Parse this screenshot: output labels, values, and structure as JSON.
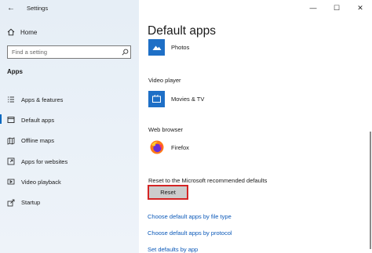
{
  "window": {
    "title": "Settings",
    "back_glyph": "←",
    "minimize_glyph": "—",
    "maximize_glyph": "☐",
    "close_glyph": "✕"
  },
  "sidebar": {
    "home_label": "Home",
    "search_placeholder": "Find a setting",
    "section_title": "Apps",
    "items": [
      {
        "label": "Apps & features",
        "icon": "apps-list-icon"
      },
      {
        "label": "Default apps",
        "icon": "default-apps-icon",
        "active": true
      },
      {
        "label": "Offline maps",
        "icon": "map-icon"
      },
      {
        "label": "Apps for websites",
        "icon": "web-link-icon"
      },
      {
        "label": "Video playback",
        "icon": "video-icon"
      },
      {
        "label": "Startup",
        "icon": "startup-icon"
      }
    ]
  },
  "main": {
    "title": "Default apps",
    "photos_app": "Photos",
    "video_label": "Video player",
    "video_app": "Movies & TV",
    "browser_label": "Web browser",
    "browser_app": "Firefox",
    "reset_label": "Reset to the Microsoft recommended defaults",
    "reset_button": "Reset",
    "links": [
      "Choose default apps by file type",
      "Choose default apps by protocol",
      "Set defaults by app"
    ]
  },
  "colors": {
    "accent": "#0067c0",
    "link": "#0a58b8",
    "highlight_border": "#d42424",
    "tile_blue": "#1e6fc6"
  }
}
